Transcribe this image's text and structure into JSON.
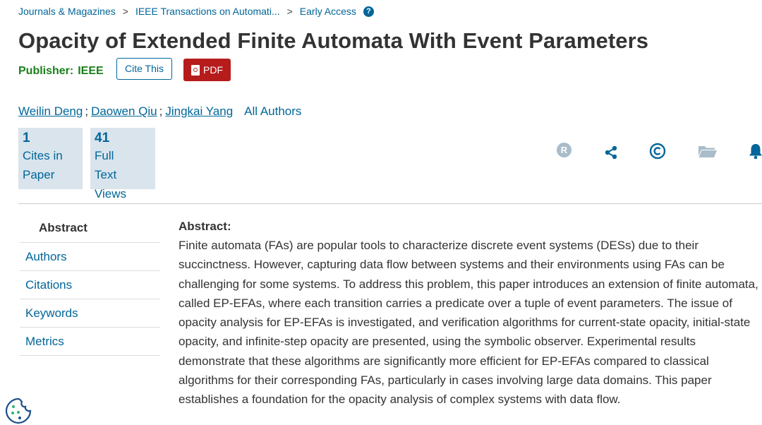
{
  "breadcrumb": {
    "items": [
      "Journals & Magazines",
      "IEEE Transactions on Automati...",
      "Early Access"
    ],
    "separator": ">",
    "help_icon": "question-circle-icon",
    "help_symbol": "?"
  },
  "article": {
    "title": "Opacity of Extended Finite Automata With Event Parameters",
    "publisher_label": "Publisher:",
    "publisher": "IEEE"
  },
  "actions": {
    "cite_label": "Cite This",
    "pdf_label": "PDF",
    "pdf_icon": "pdf-file-icon"
  },
  "authors": {
    "names": [
      "Weilin Deng",
      "Daowen Qiu",
      "Jingkai Yang"
    ],
    "separator": ";",
    "all_label": "All Authors"
  },
  "metrics": {
    "cites": {
      "value": "1",
      "label_lines": [
        "Cites in",
        "Paper"
      ]
    },
    "views": {
      "value": "41",
      "label_lines": [
        "Full",
        "Text",
        "Views"
      ]
    }
  },
  "toolbar_icons": {
    "rights": {
      "icon": "rights-r-icon",
      "glyph": "R"
    },
    "share": {
      "icon": "share-icon"
    },
    "copyright": {
      "icon": "copyright-icon"
    },
    "folder": {
      "icon": "folder-icon"
    },
    "alert": {
      "icon": "bell-icon"
    }
  },
  "side_nav": {
    "items": [
      "Abstract",
      "Authors",
      "Citations",
      "Keywords",
      "Metrics"
    ],
    "active": "Abstract"
  },
  "abstract": {
    "heading": "Abstract:",
    "text": "Finite automata (FAs) are popular tools to characterize discrete event systems (DESs) due to their succinctness. However, capturing data flow between systems and their environments using FAs can be challenging for some systems. To address this problem, this paper introduces an extension of finite automata, called EP-EFAs, where each transition carries a predicate over a tuple of event parameters. The issue of opacity analysis for EP-EFAs is investigated, and verification algorithms for current-state opacity, initial-state opacity, and infinite-step opacity are presented, using the symbolic observer. Experimental results demonstrate that these algorithms are significantly more efficient for EP-EFAs compared to classical algorithms for their corresponding FAs, particularly in cases involving large data domains. This paper establishes a foundation for the opacity analysis of complex systems with data flow."
  },
  "cookie": {
    "icon": "cookie-icon"
  },
  "colors": {
    "link": "#006699",
    "publisher": "#1a7f1a",
    "pdf_button": "#b71c1c",
    "metric_box": "#d9e4ec",
    "icon_blue": "#006699",
    "icon_grey": "#a9bcc9"
  }
}
